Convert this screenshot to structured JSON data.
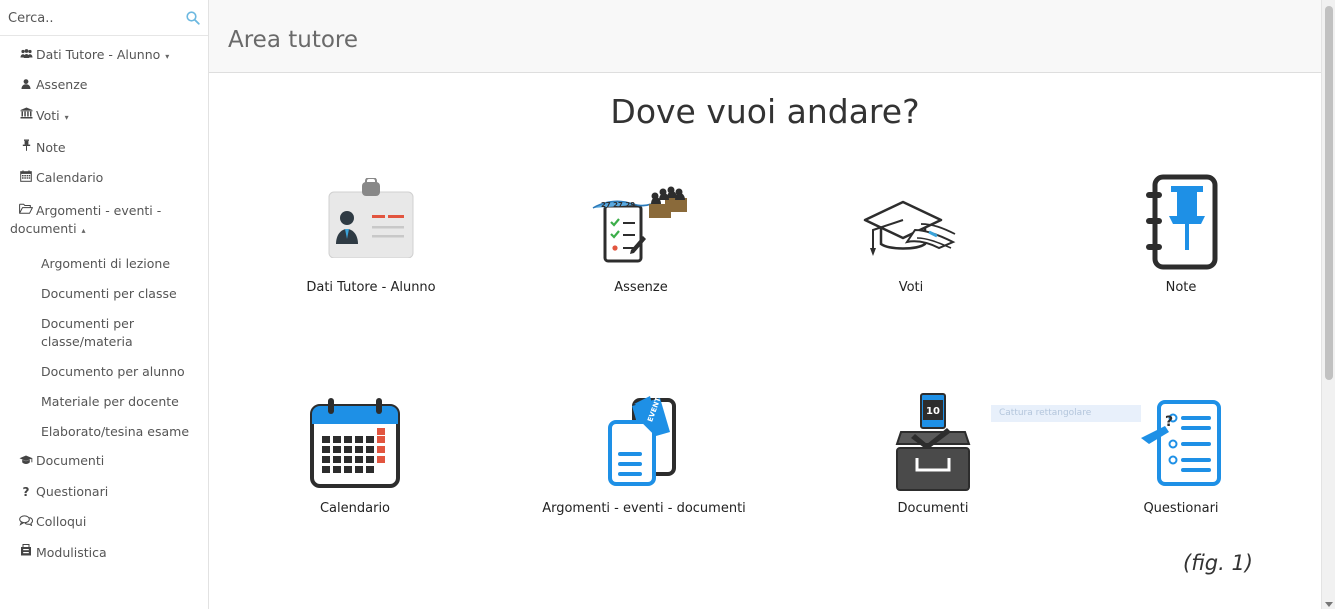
{
  "sidebar": {
    "search": {
      "placeholder": "Cerca.."
    },
    "items": [
      {
        "label": "Dati Tutore - Alunno",
        "icon": "users-icon",
        "caret": "▾"
      },
      {
        "label": "Assenze",
        "icon": "user-icon"
      },
      {
        "label": "Voti",
        "icon": "bank-icon",
        "caret": "▾"
      },
      {
        "label": "Note",
        "icon": "pin-icon"
      },
      {
        "label": "Calendario",
        "icon": "calendar-icon"
      },
      {
        "label": "Argomenti - eventi - documenti",
        "label_line1": "Argomenti - eventi -",
        "label_line2": "documenti",
        "icon": "folder-open-icon",
        "caret": "▴"
      },
      {
        "label": "Documenti",
        "icon": "graduation-cap-icon"
      },
      {
        "label": "Questionari",
        "icon": "question-icon"
      },
      {
        "label": "Colloqui",
        "icon": "comments-icon"
      },
      {
        "label": "Modulistica",
        "icon": "file-cabinet-icon"
      }
    ],
    "subitems": [
      {
        "label": "Argomenti di lezione"
      },
      {
        "label": "Documenti per classe"
      },
      {
        "label": "Documenti per classe/materia",
        "label_line1": "Documenti per",
        "label_line2": "classe/materia"
      },
      {
        "label": "Documento per alunno"
      },
      {
        "label": "Materiale per docente"
      },
      {
        "label": "Elaborato/tesina esame"
      }
    ]
  },
  "header": {
    "title": "Area tutore"
  },
  "main": {
    "heading": "Dove vuoi andare?",
    "tiles": [
      {
        "label": "Dati Tutore - Alunno",
        "icon": "id-card-icon"
      },
      {
        "label": "Assenze",
        "icon": "attendance-checklist-icon"
      },
      {
        "label": "Voti",
        "icon": "graduation-cap-diploma-icon"
      },
      {
        "label": "Note",
        "icon": "notebook-pin-icon"
      },
      {
        "label": "Calendario",
        "icon": "calendar-icon"
      },
      {
        "label": "Argomenti - eventi - documenti",
        "icon": "document-event-icon"
      },
      {
        "label": "Documenti",
        "icon": "document-tray-icon"
      },
      {
        "label": "Questionari",
        "icon": "questionnaire-icon"
      }
    ],
    "assenze_badge": "27 27 29",
    "documenti_badge": "10",
    "event_tag": "EVENT",
    "capture_text": "Cattura rettangolare",
    "fig_label": "(fig. 1)"
  },
  "colors": {
    "blue": "#1e90e6",
    "dark": "#2d2d2d",
    "sidebar_text": "#555555"
  }
}
